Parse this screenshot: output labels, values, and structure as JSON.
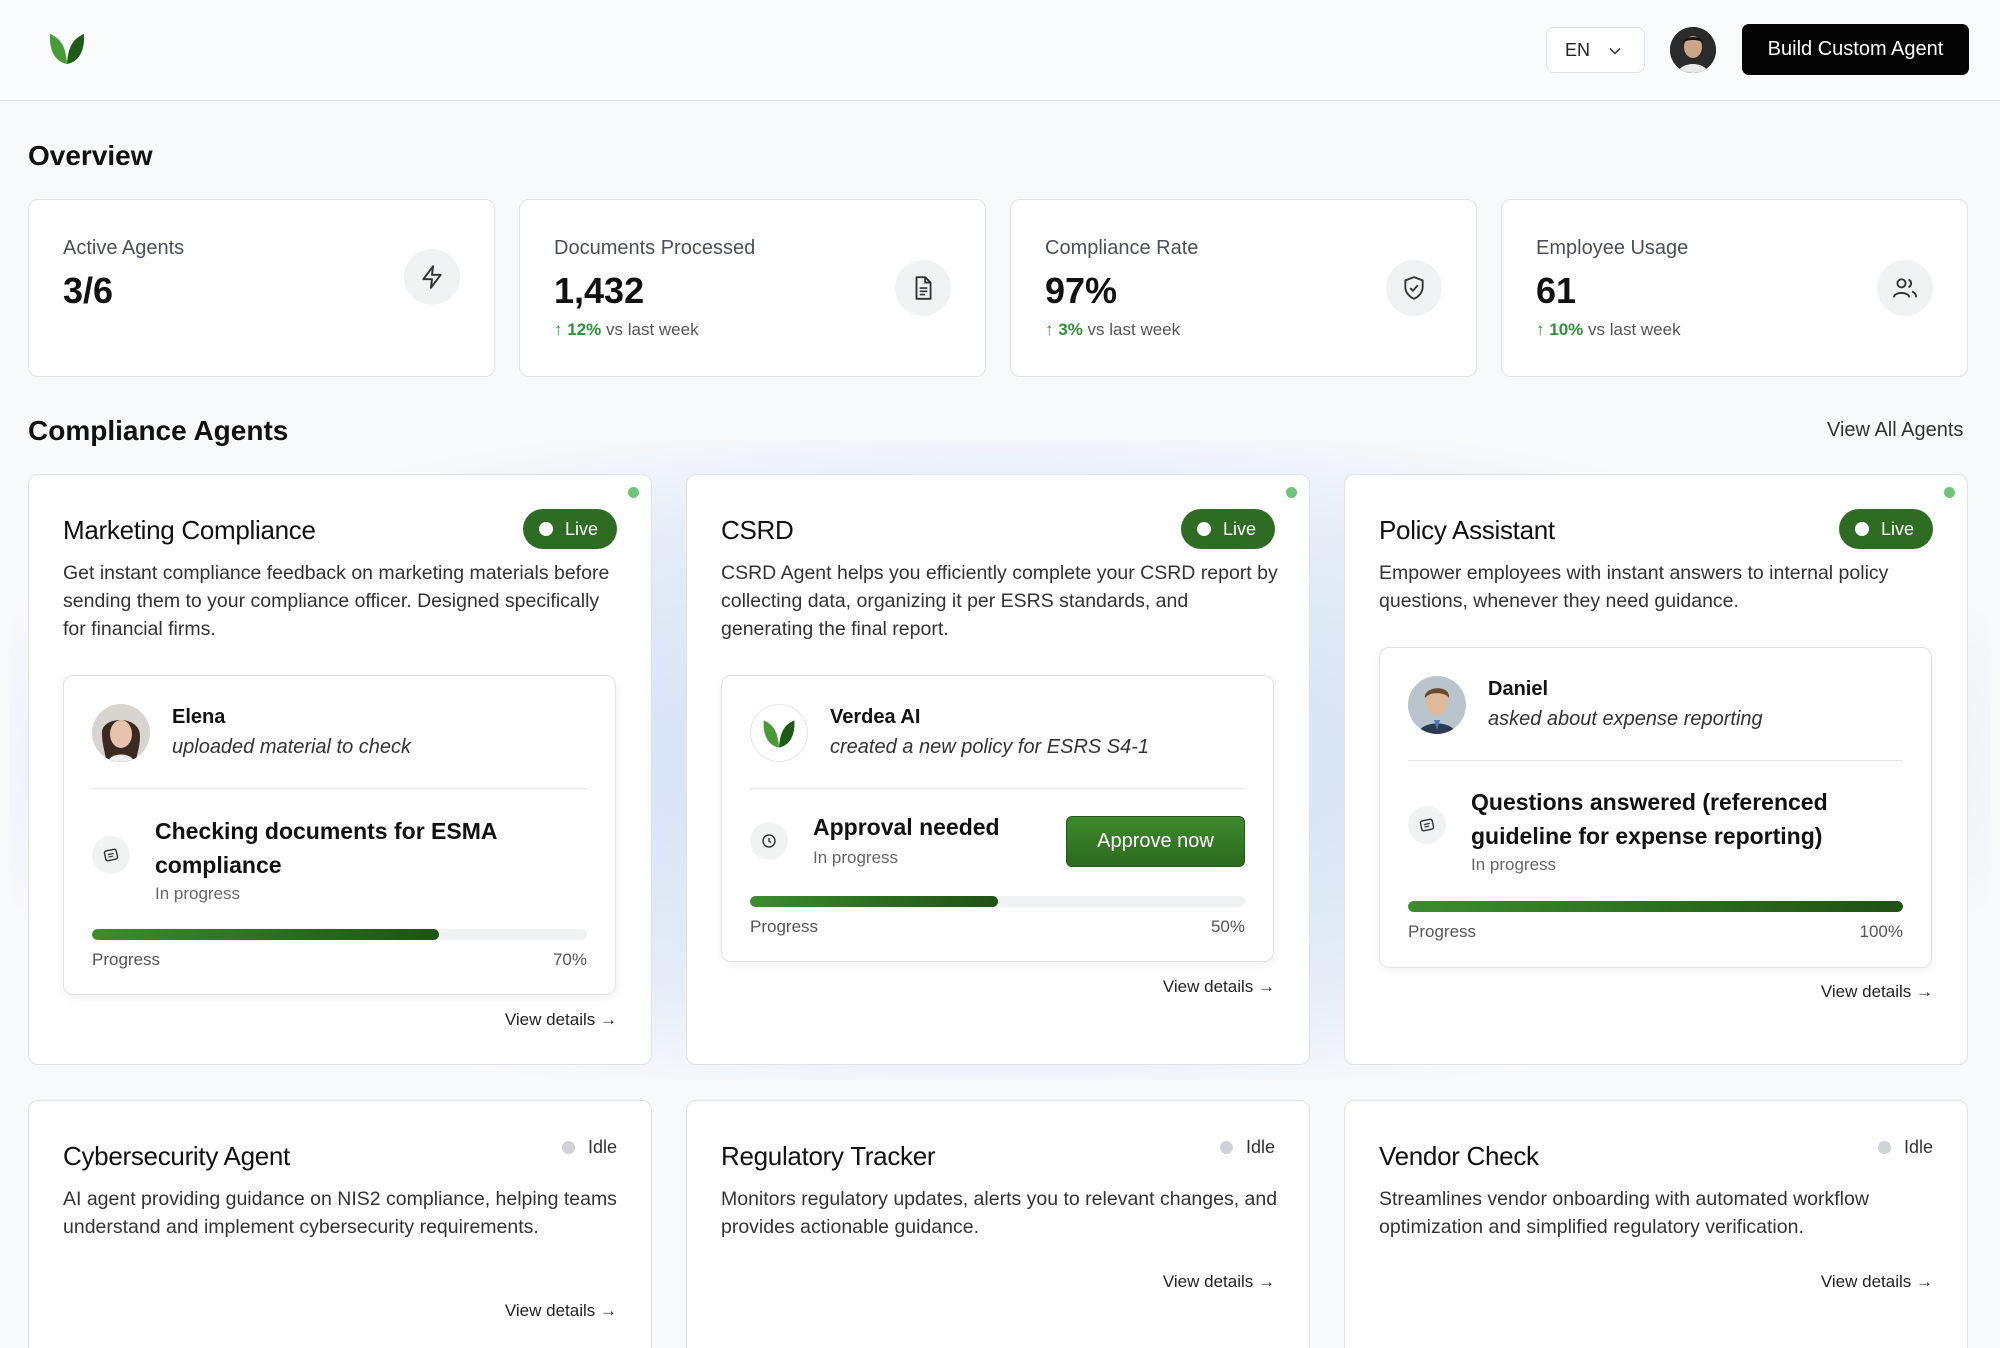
{
  "header": {
    "language": "EN",
    "build_button": "Build Custom Agent"
  },
  "overview": {
    "title": "Overview",
    "stats": [
      {
        "label": "Active Agents",
        "value": "3/6",
        "icon": "zap-icon"
      },
      {
        "label": "Documents Processed",
        "value": "1,432",
        "delta": "12%",
        "delta_text": "vs last week",
        "icon": "document-icon"
      },
      {
        "label": "Compliance Rate",
        "value": "97%",
        "delta": "3%",
        "delta_text": "vs last week",
        "icon": "shield-icon"
      },
      {
        "label": "Employee Usage",
        "value": "61",
        "delta": "10%",
        "delta_text": "vs last week",
        "icon": "users-icon"
      }
    ]
  },
  "agents_section": {
    "title": "Compliance Agents",
    "view_all": "View All Agents"
  },
  "live_agents": [
    {
      "title": "Marketing Compliance",
      "status": "Live",
      "description": "Get instant compliance feedback on marketing materials before sending them to your compliance officer. Designed specifically for financial firms.",
      "actor": "Elena",
      "action": "uploaded material to check",
      "task": "Checking documents for ESMA compliance",
      "task_status": "In progress",
      "progress_label": "Progress",
      "progress": 70,
      "progress_text": "70%",
      "details": "View details →"
    },
    {
      "title": "CSRD",
      "status": "Live",
      "description": "CSRD Agent helps you efficiently complete your CSRD report by collecting data, organizing it per ESRS standards, and generating the final report.",
      "actor": "Verdea AI",
      "action": "created a new policy for ESRS S4-1",
      "task": "Approval needed",
      "task_status": "In progress",
      "approve_button": "Approve now",
      "progress_label": "Progress",
      "progress": 50,
      "progress_text": "50%",
      "details": "View details →"
    },
    {
      "title": "Policy Assistant",
      "status": "Live",
      "description": "Empower employees with instant answers to internal policy questions, whenever they need guidance.",
      "actor": "Daniel",
      "action": "asked about expense reporting",
      "task": "Questions answered (referenced guideline for expense reporting)",
      "task_status": "In progress",
      "progress_label": "Progress",
      "progress": 100,
      "progress_text": "100%",
      "details": "View details →"
    }
  ],
  "idle_agents": [
    {
      "title": "Cybersecurity Agent",
      "status": "Idle",
      "description": "AI agent providing guidance on NIS2 compliance, helping teams understand and implement cybersecurity requirements.",
      "details": "View details →"
    },
    {
      "title": "Regulatory Tracker",
      "status": "Idle",
      "description": "Monitors regulatory updates, alerts you to relevant changes, and provides actionable guidance.",
      "details": "View details →"
    },
    {
      "title": "Vendor Check",
      "status": "Idle",
      "description": "Streamlines vendor onboarding with automated workflow optimization and simplified regulatory verification.",
      "details": "View details →"
    }
  ],
  "colors": {
    "brand_green": "#2e6c23",
    "delta_green": "#2f8f3a",
    "live_dot": "#6fc47a",
    "idle_dot": "#cfd2d6"
  }
}
